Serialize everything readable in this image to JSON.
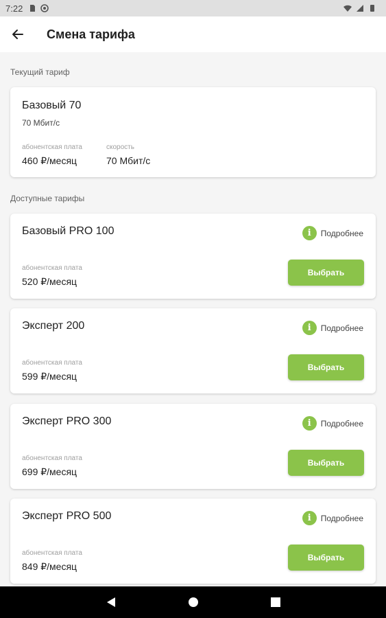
{
  "status_bar": {
    "time": "7:22"
  },
  "header": {
    "title": "Смена тарифа"
  },
  "current": {
    "section_label": "Текущий тариф",
    "name": "Базовый 70",
    "speed_line": "70  Мбит/с",
    "fee_caption": "абонентская плата",
    "fee_value": "460 ₽/месяц",
    "speed_caption": "скорость",
    "speed_value": "70 Мбит/с"
  },
  "available": {
    "section_label": "Доступные тарифы",
    "details_label": "Подробнее",
    "fee_caption": "абонентская плата",
    "choose_label": "Выбрать",
    "plans": [
      {
        "name": "Базовый PRO 100",
        "price": "520 ₽/месяц"
      },
      {
        "name": "Эксперт 200",
        "price": "599 ₽/месяц"
      },
      {
        "name": "Эксперт PRO 300",
        "price": "699 ₽/месяц"
      },
      {
        "name": "Эксперт PRO 500",
        "price": "849 ₽/месяц"
      }
    ]
  },
  "colors": {
    "accent": "#8bc34a",
    "background": "#f5f5f5",
    "card": "#ffffff"
  }
}
